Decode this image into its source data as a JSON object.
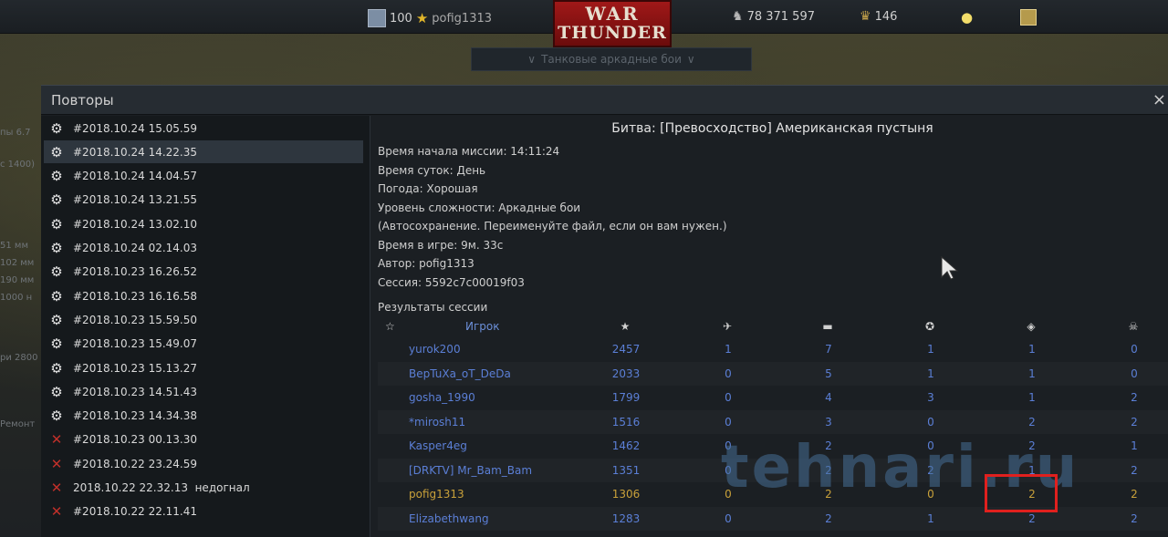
{
  "topbar": {
    "level": "100",
    "player_name": "pofig1313",
    "logo_line1": "WAR",
    "logo_line2": "THUNDER",
    "silver_lions": "78 371 597",
    "eagles": "146",
    "mode_selector": "Танковые аркадные бои",
    "icons": [
      "avatar-icon",
      "rank-star-icon",
      "silver-lions-icon",
      "golden-eagles-icon",
      "lightbulb-icon",
      "premium-badge-icon"
    ]
  },
  "background": {
    "left_text": [
      "пы 6.7",
      "с 1400)",
      "51 мм",
      "102 мм",
      "190 мм",
      "1000 н",
      "ри 2800",
      "Ремонт"
    ]
  },
  "window": {
    "title": "Повторы",
    "close": "×"
  },
  "replays": [
    {
      "label": "#2018.10.24 15.05.59",
      "icon": "gear-icon",
      "selected": false
    },
    {
      "label": "#2018.10.24 14.22.35",
      "icon": "gear-icon",
      "selected": true
    },
    {
      "label": "#2018.10.24 14.04.57",
      "icon": "gear-icon",
      "selected": false
    },
    {
      "label": "#2018.10.24 13.21.55",
      "icon": "gear-icon",
      "selected": false
    },
    {
      "label": "#2018.10.24 13.02.10",
      "icon": "gear-icon",
      "selected": false
    },
    {
      "label": "#2018.10.24 02.14.03",
      "icon": "gear-icon",
      "selected": false
    },
    {
      "label": "#2018.10.23 16.26.52",
      "icon": "gear-icon",
      "selected": false
    },
    {
      "label": "#2018.10.23 16.16.58",
      "icon": "gear-icon",
      "selected": false
    },
    {
      "label": "#2018.10.23 15.59.50",
      "icon": "gear-icon",
      "selected": false
    },
    {
      "label": "#2018.10.23 15.49.07",
      "icon": "gear-icon",
      "selected": false
    },
    {
      "label": "#2018.10.23 15.13.27",
      "icon": "gear-icon",
      "selected": false
    },
    {
      "label": "#2018.10.23 14.51.43",
      "icon": "gear-icon",
      "selected": false
    },
    {
      "label": "#2018.10.23 14.34.38",
      "icon": "gear-icon",
      "selected": false
    },
    {
      "label": "#2018.10.23 00.13.30",
      "icon": "error-x-icon",
      "selected": false
    },
    {
      "label": "#2018.10.22 23.24.59",
      "icon": "error-x-icon",
      "selected": false
    },
    {
      "label": "2018.10.22 22.32.13  недогнал",
      "icon": "error-x-icon",
      "selected": false
    },
    {
      "label": "#2018.10.22 22.11.41",
      "icon": "error-x-icon",
      "selected": false
    }
  ],
  "details": {
    "battle_title": "Битва: [Превосходство] Американская пустыня",
    "info": [
      "Время начала миссии: 14:11:24",
      "Время суток: День",
      "Погода: Хорошая",
      "Уровень сложности: Аркадные бои",
      "(Автосохранение. Переименуйте файл, если он вам нужен.)",
      "Время в игре: 9м. 33с",
      "Автор: pofig1313",
      "Сессия: 5592c7c00019f03"
    ],
    "results_label": "Результаты сессии",
    "player_header": "Игрок",
    "header_icons": [
      "rank-star-icon",
      "score-star-icon",
      "aircraft-kill-icon",
      "ground-kill-icon",
      "assist-icon",
      "capture-icon",
      "death-skull-icon"
    ]
  },
  "results": [
    {
      "name": "yurok200",
      "score": "2457",
      "air": "1",
      "ground": "7",
      "assist": "1",
      "capture": "1",
      "deaths": "0",
      "me": false
    },
    {
      "name": "BepTuXa_oT_DeDa",
      "score": "2033",
      "air": "0",
      "ground": "5",
      "assist": "1",
      "capture": "1",
      "deaths": "0",
      "me": false
    },
    {
      "name": "gosha_1990",
      "score": "1799",
      "air": "0",
      "ground": "4",
      "assist": "3",
      "capture": "1",
      "deaths": "2",
      "me": false
    },
    {
      "name": "*mirosh11",
      "score": "1516",
      "air": "0",
      "ground": "3",
      "assist": "0",
      "capture": "2",
      "deaths": "2",
      "me": false
    },
    {
      "name": "Kasper4eg",
      "score": "1462",
      "air": "0",
      "ground": "2",
      "assist": "0",
      "capture": "2",
      "deaths": "1",
      "me": false
    },
    {
      "name": "[DRKTV] Mr_Bam_Bam",
      "score": "1351",
      "air": "0",
      "ground": "2",
      "assist": "2",
      "capture": "1",
      "deaths": "2",
      "me": false
    },
    {
      "name": "pofig1313",
      "score": "1306",
      "air": "0",
      "ground": "2",
      "assist": "0",
      "capture": "2",
      "deaths": "2",
      "me": true
    },
    {
      "name": "Elizabethwang",
      "score": "1283",
      "air": "0",
      "ground": "2",
      "assist": "1",
      "capture": "2",
      "deaths": "2",
      "me": false
    }
  ],
  "watermark": "tehnari.ru",
  "colors": {
    "accent_blue": "#5b7fd6",
    "self_gold": "#c9a13a",
    "error_red": "#c0302a",
    "highlight_red": "#e0201e"
  }
}
